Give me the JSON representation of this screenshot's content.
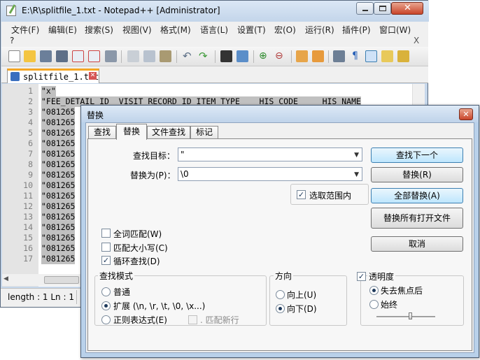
{
  "window": {
    "title": "E:\\R\\splitfile_1.txt - Notepad++ [Administrator]",
    "menu": [
      "文件(F)",
      "编辑(E)",
      "搜索(S)",
      "视图(V)",
      "格式(M)",
      "语言(L)",
      "设置(T)",
      "宏(O)",
      "运行(R)",
      "插件(P)",
      "窗口(W)"
    ],
    "menu_extra": "?",
    "menu_close": "X",
    "tab_label": "splitfile_1.txt",
    "status_text": "length : 1   Ln : 1"
  },
  "editor": {
    "line_numbers": [
      "1",
      "2",
      "3",
      "4",
      "5",
      "6",
      "7",
      "8",
      "9",
      "10",
      "11",
      "12",
      "13",
      "14",
      "15",
      "16",
      "17"
    ],
    "lines": [
      "\"x\"",
      "\"FEE_DETAIL_ID  VISIT_RECORD_ID ITEM_TYPE    HIS_CODE     HIS_NAME",
      "\"081265",
      "\"081265",
      "\"081265",
      "\"081265",
      "\"081265",
      "\"081265",
      "\"081265",
      "\"081265",
      "\"081265",
      "\"081265",
      "\"081265",
      "\"081265",
      "\"081265",
      "\"081265",
      "\"081265"
    ]
  },
  "dialog": {
    "title": "替换",
    "close": "✕",
    "tabs": [
      "查找",
      "替换",
      "文件查找",
      "标记"
    ],
    "find_label": "查找目标：",
    "find_value": "\"",
    "replace_label": "替换为(P)：",
    "replace_value": "\\0",
    "in_selection": "选取范围内",
    "buttons": {
      "find_next": "查找下一个",
      "replace": "替换(R)",
      "replace_all": "全部替换(A)",
      "replace_all_open": "替换所有打开文件",
      "cancel": "取消"
    },
    "options": {
      "whole_word": "全词匹配(W)",
      "match_case": "匹配大小写(C)",
      "wrap_around": "循环查找(D)"
    },
    "search_mode": {
      "title": "查找模式",
      "normal": "普通",
      "extended": "扩展 (\\n, \\r, \\t, \\0, \\x...)",
      "regex": "正则表达式(E)",
      "dot_newline": ". 匹配新行"
    },
    "direction": {
      "title": "方向",
      "up": "向上(U)",
      "down": "向下(D)"
    },
    "transparency": {
      "title": "透明度",
      "on_lose_focus": "失去焦点后",
      "always": "始终"
    }
  }
}
